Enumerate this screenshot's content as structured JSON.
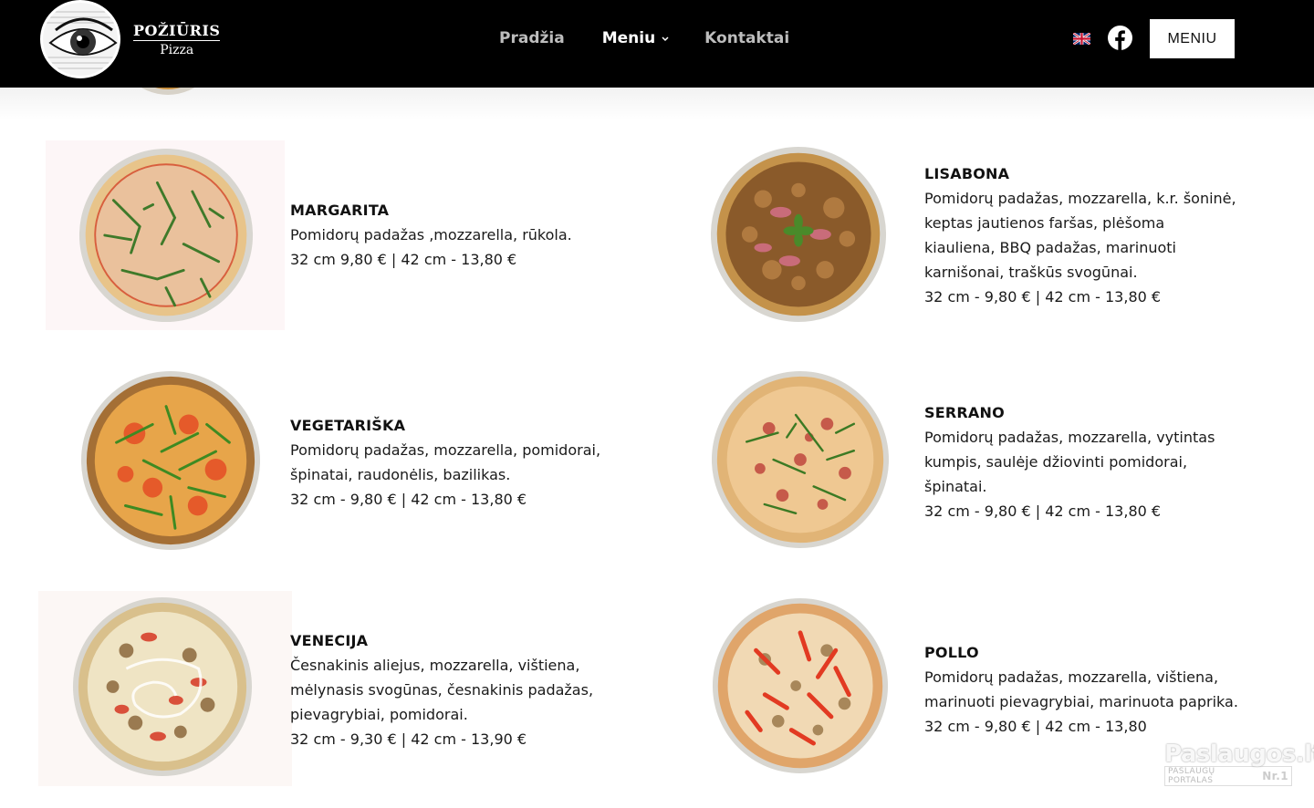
{
  "header": {
    "logo_title": "POŽIŪRIS",
    "logo_subtitle": "Pizza",
    "nav": {
      "home": "Pradžia",
      "menu": "Meniu",
      "contacts": "Kontaktai"
    },
    "menu_button": "MENIU",
    "colors": {
      "background": "#000000",
      "nav_active": "#ffffff",
      "nav_inactive": "#bdbdbd"
    }
  },
  "menu_items": [
    {
      "name": "MARGARITA",
      "description": "Pomidorų padažas ,mozzarella, rūkola.",
      "price": "32 cm 9,80 € | 42 cm - 13,80 €"
    },
    {
      "name": "LISABONA",
      "description": "Pomidorų padažas, mozzarella, k.r. šoninė, keptas jautienos faršas, plėšoma kiauliena, BBQ padažas, marinuoti karnišonai, traškūs svogūnai.",
      "price": "32 cm - 9,80 € | 42 cm - 13,80 €"
    },
    {
      "name": "VEGETARIŠKA",
      "description": "Pomidorų padažas, mozzarella, pomidorai, špinatai, raudonėlis, bazilikas.",
      "price": "32 cm - 9,80 € | 42 cm - 13,80 €"
    },
    {
      "name": "SERRANO",
      "description": "Pomidorų padažas, mozzarella, vytintas kumpis, saulėje džiovinti pomidorai, špinatai.",
      "price": "32 cm - 9,80 € | 42 cm - 13,80 €"
    },
    {
      "name": "VENECIJA",
      "description": "Česnakinis aliejus, mozzarella, vištiena, mėlynasis svogūnas, česnakinis padažas, pievagrybiai, pomidorai.",
      "price": "32 cm - 9,30 € | 42 cm - 13,90 €"
    },
    {
      "name": "POLLO",
      "description": "Pomidorų padažas, mozzarella, vištiena, marinuoti pievagrybiai, marinuota paprika.",
      "price": "32 cm - 9,80 € | 42 cm - 13,80"
    }
  ],
  "watermark": {
    "main": "Paslaugos.lt",
    "sub": "PASLAUGŲ PORTALAS",
    "nr": "Nr.1"
  },
  "icons": [
    "uk-flag-icon",
    "facebook-icon",
    "chevron-down-icon"
  ]
}
